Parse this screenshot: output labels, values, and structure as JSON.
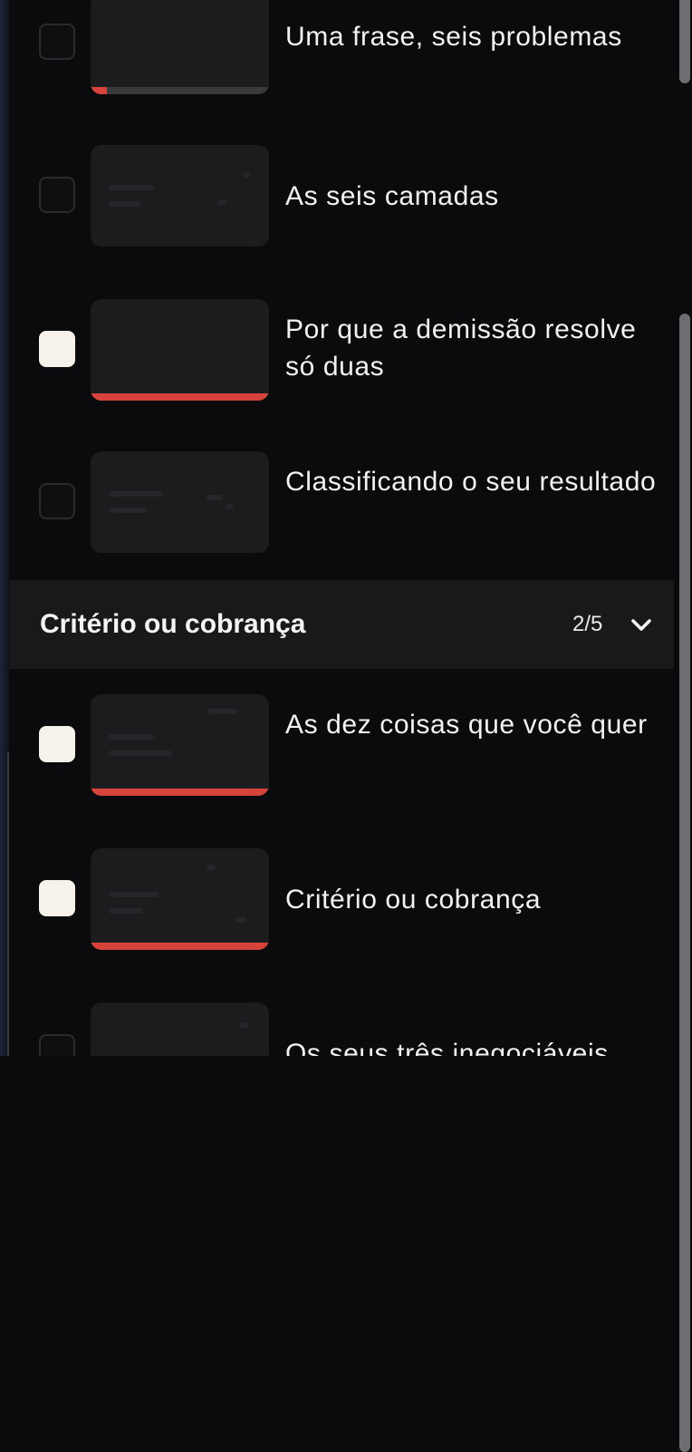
{
  "lessons_top": [
    {
      "title": "Uma frase, seis problemas",
      "checked": false,
      "progress": 0.09
    },
    {
      "title": "As seis camadas",
      "checked": false,
      "progress": 0
    },
    {
      "title": "Por que a demissão resolve só duas",
      "checked": true,
      "progress": 1.0
    },
    {
      "title": "Classificando o seu resultado",
      "checked": false,
      "progress": 0
    }
  ],
  "section": {
    "title": "Critério ou cobrança",
    "count": "2/5",
    "icon": "chevron-down-icon"
  },
  "lessons_section": [
    {
      "title": "As dez coisas que você quer",
      "checked": true,
      "progress": 1.0
    },
    {
      "title": "Critério ou cobrança",
      "checked": true,
      "progress": 1.0
    },
    {
      "title": "Os seus três inegociáveis",
      "checked": false,
      "progress": 0
    }
  ],
  "colors": {
    "background": "#0b0b0d",
    "section_header": "#19191c",
    "progress_fill": "#d6433b",
    "checkbox_checked": "#f6f2ea"
  }
}
